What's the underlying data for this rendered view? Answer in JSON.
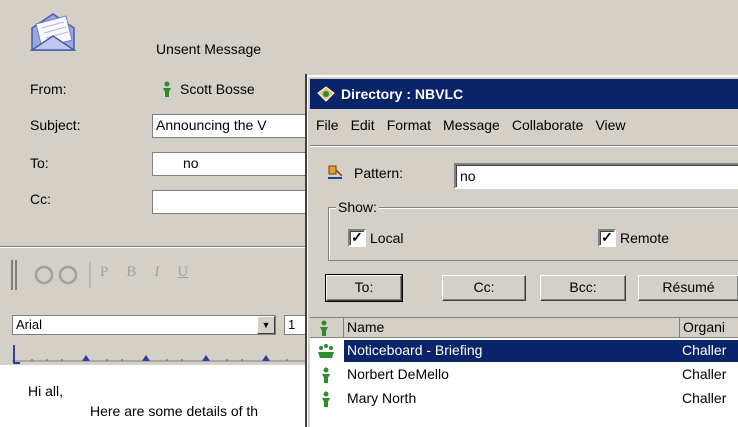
{
  "mail": {
    "title": "Unsent Message",
    "from_label": "From:",
    "from_value": "Scott Bosse",
    "subject_label": "Subject:",
    "subject_value": "Announcing the V",
    "to_label": "To:",
    "to_value": "no",
    "cc_label": "Cc:",
    "cc_value": "",
    "font_name": "Arial",
    "font_size": "1",
    "body_line1": "Hi all,",
    "body_line2": "Here are some details of th",
    "format_buttons": [
      "P",
      "B",
      "I",
      "U"
    ]
  },
  "directory": {
    "title": "Directory : NBVLC",
    "menu": [
      "File",
      "Edit",
      "Format",
      "Message",
      "Collaborate",
      "View"
    ],
    "pattern_label": "Pattern:",
    "pattern_value": "no",
    "show_label": "Show:",
    "local_label": "Local",
    "local_checked": true,
    "remote_label": "Remote",
    "remote_checked": true,
    "buttons": {
      "to": "To:",
      "cc": "Cc:",
      "bcc": "Bcc:",
      "resume": "Résumé"
    },
    "columns": {
      "name": "Name",
      "org": "Organi"
    },
    "rows": [
      {
        "name": "Noticeboard - Briefing",
        "org": "Challer",
        "icon": "noticeboard-icon",
        "selected": true
      },
      {
        "name": "Norbert DeMello",
        "org": "Challer",
        "icon": "person-icon",
        "selected": false
      },
      {
        "name": "Mary North",
        "org": "Challer",
        "icon": "person-icon",
        "selected": false
      }
    ]
  },
  "colors": {
    "titlebar": "#0a246a",
    "window": "#d4d0c8",
    "person_icon": "#2e8b2e"
  }
}
